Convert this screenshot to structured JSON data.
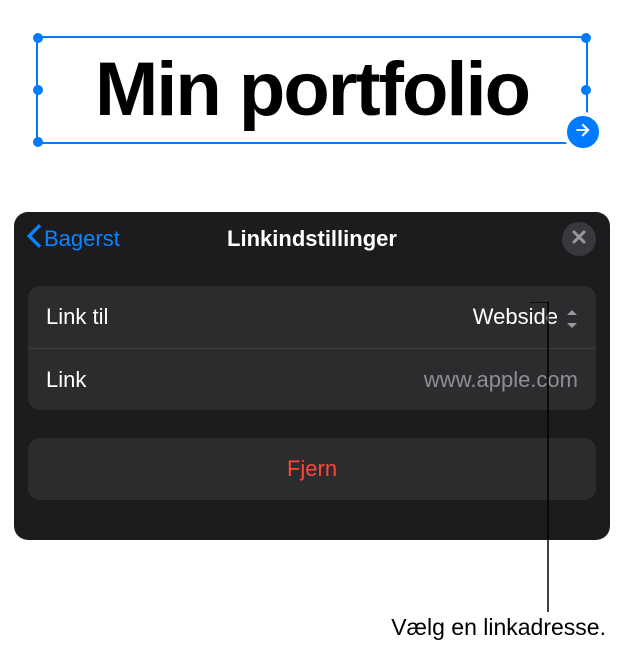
{
  "textbox": {
    "text": "Min portfolio"
  },
  "panel": {
    "back_label": "Bagerst",
    "title": "Linkindstillinger",
    "rows": {
      "link_to": {
        "label": "Link til",
        "value": "Webside"
      },
      "link": {
        "label": "Link",
        "placeholder": "www.apple.com"
      }
    },
    "remove_label": "Fjern"
  },
  "callout": {
    "text": "Vælg en linkadresse."
  }
}
